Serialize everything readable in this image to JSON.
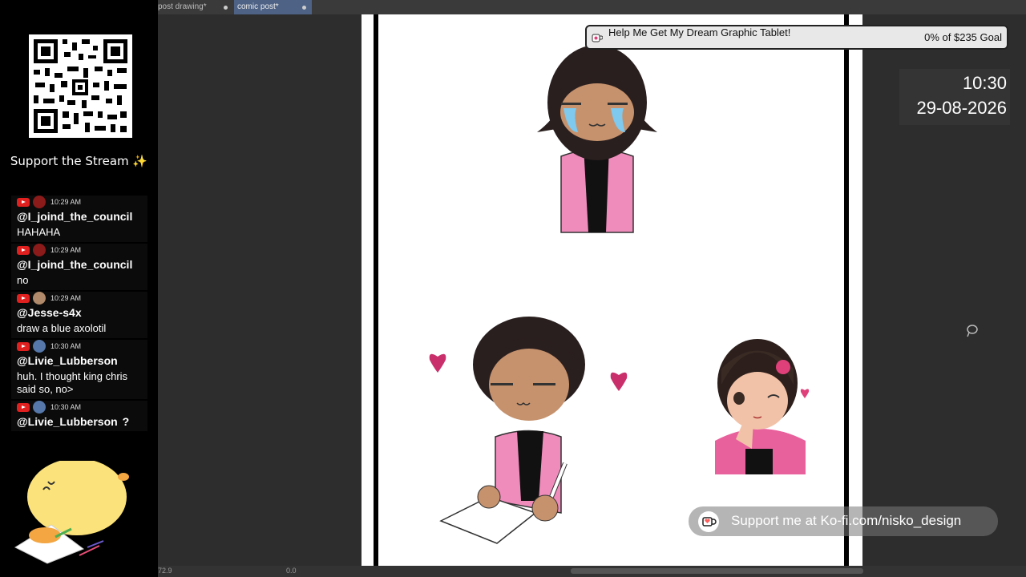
{
  "sidebar": {
    "support_text": "Support the Stream ✨",
    "chat": [
      {
        "time": "10:29 AM",
        "user": "@I_joind_the_council",
        "text": "HAHAHA",
        "avatar_color": "#8b1a1a"
      },
      {
        "time": "10:29 AM",
        "user": "@I_joind_the_council",
        "text": "no",
        "avatar_color": "#8b1a1a"
      },
      {
        "time": "10:29 AM",
        "user": "@Jesse-s4x",
        "text": "draw a blue axolotil",
        "avatar_color": "#b08a6a"
      },
      {
        "time": "10:30 AM",
        "user": "@Livie_Lubberson",
        "text": "huh. I thought king chris said so, no>",
        "avatar_color": "#5577aa"
      },
      {
        "time": "10:30 AM",
        "user": "@Livie_Lubberson",
        "text": "?",
        "avatar_color": "#5577aa"
      }
    ]
  },
  "tabs": [
    {
      "label": "post drawing*"
    },
    {
      "label": "comic post*"
    }
  ],
  "goal": {
    "title": "Help Me Get My Dream Graphic Tablet!",
    "amount": "0% of $235 Goal",
    "progress": 0
  },
  "clock": {
    "time": "10:30",
    "date": "29-08-2026"
  },
  "kofi": {
    "text": "Support me at Ko-fi.com/nisko_design"
  },
  "status": {
    "zoom": "72.9",
    "angle": "0.0"
  },
  "colors": {
    "accent": "#4d6285",
    "jacket": "#f08cbc",
    "heart": "#c9306b",
    "youtube": "#e0201f"
  }
}
